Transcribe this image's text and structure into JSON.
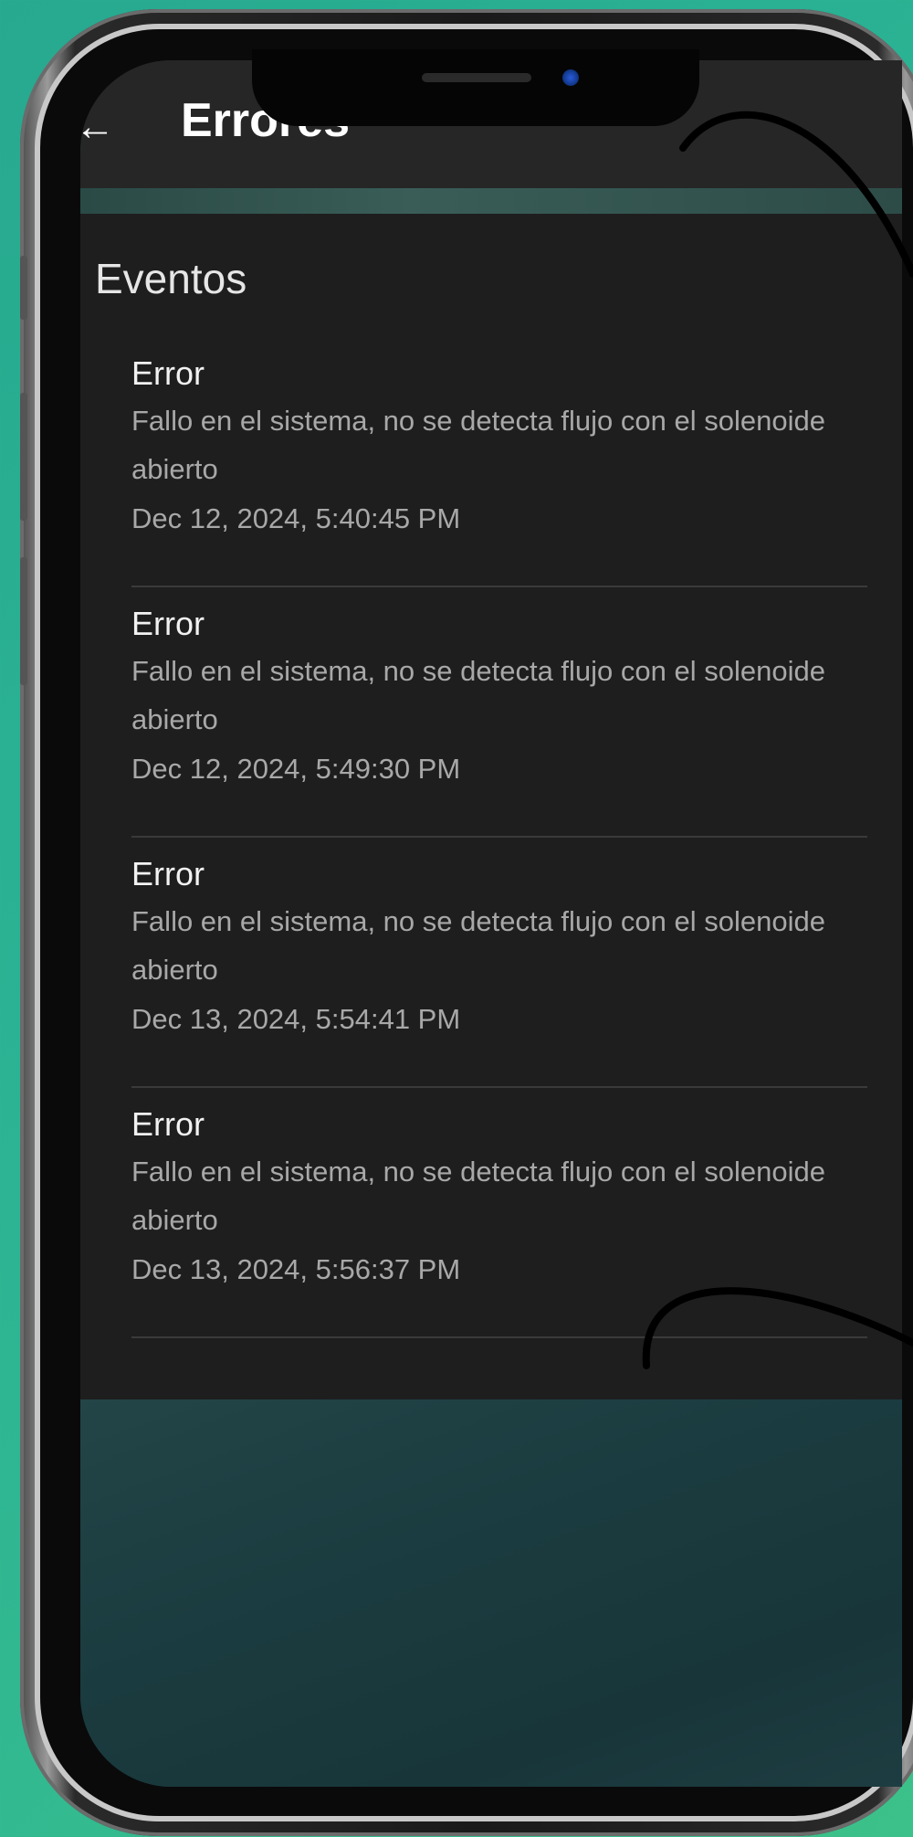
{
  "appbar": {
    "title": "Errores",
    "back_icon": "arrow-left-icon"
  },
  "section": {
    "title": "Eventos"
  },
  "events": [
    {
      "title": "Error",
      "description": "Fallo en el sistema, no se detecta flujo con el solenoide abierto",
      "timestamp": "Dec 12, 2024, 5:40:45 PM"
    },
    {
      "title": "Error",
      "description": "Fallo en el sistema, no se detecta flujo con el solenoide abierto",
      "timestamp": "Dec 12, 2024, 5:49:30 PM"
    },
    {
      "title": "Error",
      "description": "Fallo en el sistema, no se detecta flujo con el solenoide abierto",
      "timestamp": "Dec 13, 2024, 5:54:41 PM"
    },
    {
      "title": "Error",
      "description": "Fallo en el sistema, no se detecta flujo con el solenoide abierto",
      "timestamp": "Dec 13, 2024, 5:56:37 PM"
    }
  ],
  "colors": {
    "background": "#2bb394",
    "appbar": "#262626",
    "sheet": "#1e1e1e",
    "title_text": "#f2f2f2",
    "secondary_text": "#a8a8a8",
    "divider": "#3a3a3a"
  }
}
